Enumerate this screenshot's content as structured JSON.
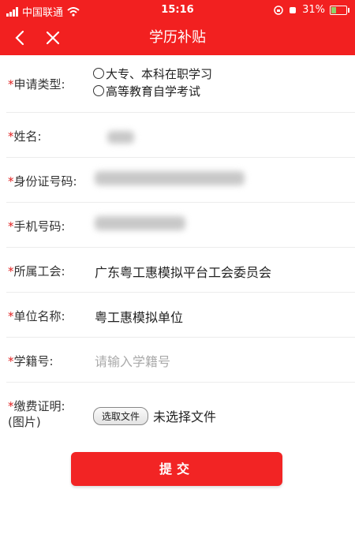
{
  "status_bar": {
    "carrier": "中国联通",
    "time": "15:16",
    "battery": "31%",
    "battery_level": 0.31
  },
  "nav": {
    "title": "学历补贴"
  },
  "form": {
    "required_mark": "*",
    "apply_type": {
      "label": "申请类型:",
      "options": [
        "大专、本科在职学习",
        "高等教育自学考试"
      ]
    },
    "name": {
      "label": "姓名:"
    },
    "id_number": {
      "label": "身份证号码:"
    },
    "phone": {
      "label": "手机号码:"
    },
    "union": {
      "label": "所属工会:",
      "value": "广东粤工惠模拟平台工会委员会"
    },
    "unit": {
      "label": "单位名称:",
      "value": "粤工惠模拟单位"
    },
    "student_no": {
      "label": "学籍号:",
      "placeholder": "请输入学籍号"
    },
    "payment_proof": {
      "label": "缴费证明:",
      "sublabel": "(图片)",
      "button": "选取文件",
      "status": "未选择文件"
    }
  },
  "submit_label": "提交"
}
